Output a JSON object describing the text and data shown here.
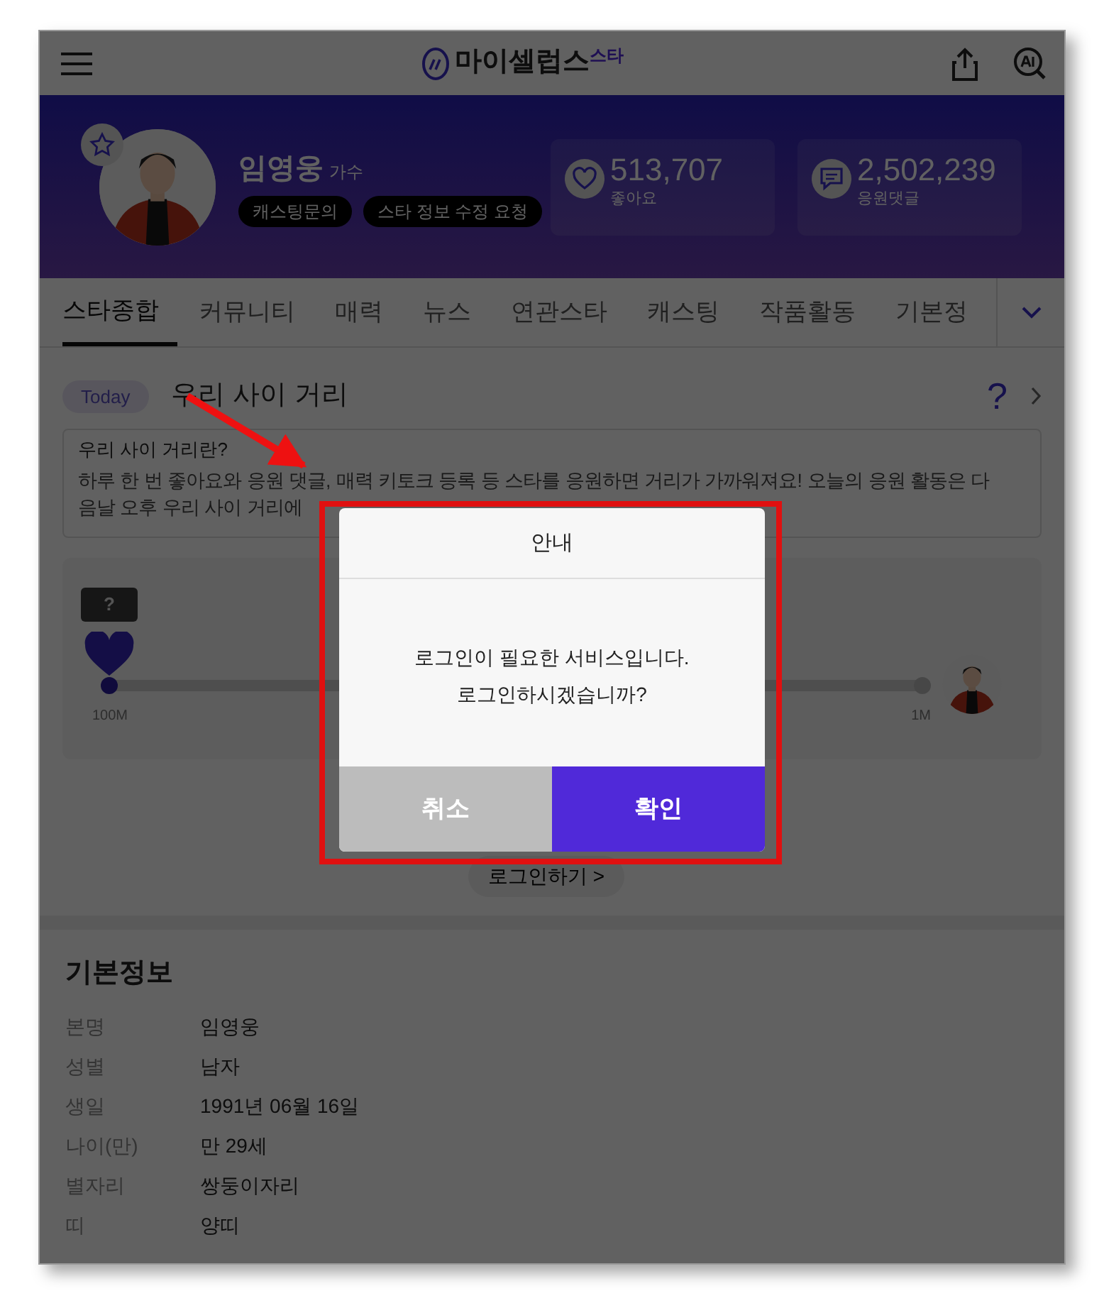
{
  "header": {
    "logo": "마이셀럽스",
    "logo_sup": "스타"
  },
  "profile": {
    "name": "임영웅",
    "role": "가수",
    "buttons": [
      "캐스팅문의",
      "스타 정보 수정 요청"
    ],
    "stats": [
      {
        "kind": "likes",
        "value": "513,707",
        "label": "좋아요"
      },
      {
        "kind": "comments",
        "value": "2,502,239",
        "label": "응원댓글"
      }
    ]
  },
  "tabs": [
    {
      "label": "스타종합",
      "selected": true
    },
    {
      "label": "커뮤니티",
      "selected": false
    },
    {
      "label": "매력",
      "selected": false
    },
    {
      "label": "뉴스",
      "selected": false
    },
    {
      "label": "연관스타",
      "selected": false
    },
    {
      "label": "캐스팅",
      "selected": false
    },
    {
      "label": "작품활동",
      "selected": false
    },
    {
      "label": "기본정",
      "selected": false
    }
  ],
  "today": {
    "badge": "Today",
    "title": "우리 사이 거리",
    "help": "?",
    "info_title": "우리 사이 거리란?",
    "info_lines": [
      "하루 한 번 좋아요와 응원 댓글, 매력 키토크 등록 등 스타를 응원하면 거리가 가까워져요! 오늘의 응원 활동은 다",
      "음날 오후 우리 사이 거리에"
    ],
    "bubble": "?",
    "start_label": "100M",
    "end_label": "1M",
    "login_link": "로그인하기 >"
  },
  "basic_info": {
    "title": "기본정보",
    "rows": [
      {
        "label": "본명",
        "value": "임영웅"
      },
      {
        "label": "성별",
        "value": "남자"
      },
      {
        "label": "생일",
        "value": "1991년 06월 16일"
      },
      {
        "label": "나이(만)",
        "value": "만 29세"
      },
      {
        "label": "별자리",
        "value": "쌍둥이자리"
      },
      {
        "label": "띠",
        "value": "양띠"
      }
    ]
  },
  "dialog": {
    "title": "안내",
    "message": [
      "로그인이 필요한 서비스입니다.",
      "로그인하시겠습니까?"
    ],
    "buttons": [
      {
        "kind": "cancel",
        "label": "취소"
      },
      {
        "kind": "confirm",
        "label": "확인"
      }
    ]
  }
}
